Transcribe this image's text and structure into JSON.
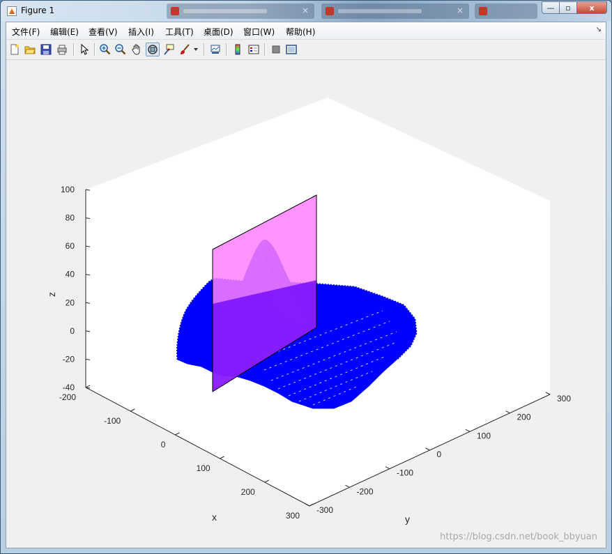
{
  "window": {
    "title": "Figure 1",
    "background_tabs": 4,
    "buttons": {
      "minimize": "—",
      "maximize": "▫",
      "close": "x"
    }
  },
  "menubar": {
    "items": [
      {
        "label": "文件(F)"
      },
      {
        "label": "编辑(E)"
      },
      {
        "label": "查看(V)"
      },
      {
        "label": "插入(I)"
      },
      {
        "label": "工具(T)"
      },
      {
        "label": "桌面(D)"
      },
      {
        "label": "窗口(W)"
      },
      {
        "label": "帮助(H)"
      }
    ],
    "corner_glyph": "↘"
  },
  "toolbar": {
    "icons": [
      "new-figure-icon",
      "open-file-icon",
      "save-icon",
      "print-icon",
      "pointer-icon",
      "zoom-in-icon",
      "zoom-out-icon",
      "pan-hand-icon",
      "rotate-3d-icon",
      "data-cursor-icon",
      "brush-icon",
      "brush-dropdown-icon",
      "link-plot-icon",
      "colorbar-icon",
      "legend-icon",
      "hide-plot-tools-icon",
      "show-plot-tools-icon"
    ],
    "active": "rotate-3d-icon"
  },
  "axes": {
    "xlabel": "x",
    "ylabel": "y",
    "zlabel": "z",
    "x_ticks": [
      "-200",
      "-100",
      "0",
      "100",
      "200",
      "300"
    ],
    "y_ticks": [
      "-300",
      "-200",
      "-100",
      "0",
      "100",
      "200",
      "300"
    ],
    "z_ticks": [
      "100",
      "80",
      "60",
      "40",
      "20",
      "0",
      "-20",
      "-40"
    ],
    "colors": {
      "surface": "#0000ff",
      "plane": "#ff80ff",
      "plane_edge": "#000000",
      "axes_bg": "#ffffff",
      "figure_bg": "#f0f0f0"
    }
  },
  "chart_data": {
    "type": "surface",
    "xlabel": "x",
    "ylabel": "y",
    "zlabel": "z",
    "xlim": [
      -200,
      300
    ],
    "ylim": [
      -300,
      300
    ],
    "zlim": [
      -40,
      100
    ],
    "series": [
      {
        "peak": {
          "x": -50,
          "y": 0,
          "z": 75
        },
        "baseline_z": 20,
        "min_z": -30
      }
    ],
    "plane": {
      "at": "y ≈ -50",
      "z_range": [
        -20,
        100
      ]
    }
  },
  "watermark": "https://blog.csdn.net/book_bbyuan"
}
